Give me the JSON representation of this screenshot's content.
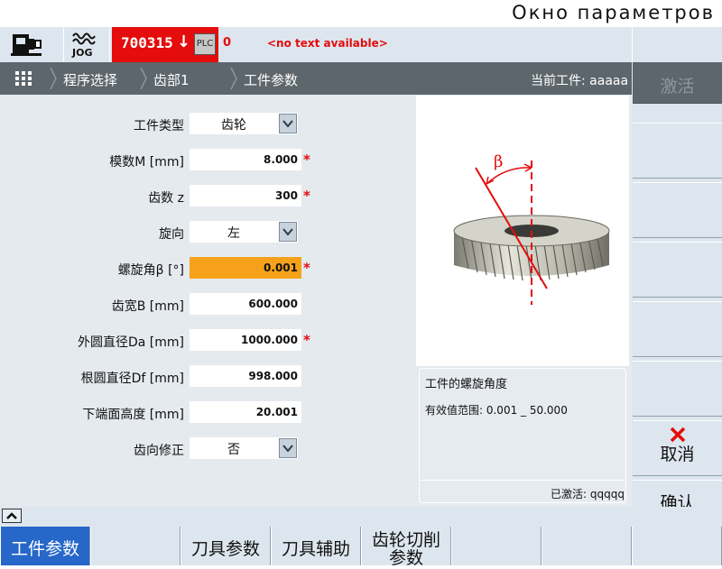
{
  "window_title": "Окно параметров",
  "header": {
    "mode": "JOG",
    "alarm_number": "700315",
    "plc_label": "PLC",
    "alarm_count": "0",
    "alarm_text": "<no text available>",
    "alarm_color": "#e40c0c"
  },
  "breadcrumb": {
    "items": [
      "程序选择",
      "齿部1",
      "工件参数"
    ],
    "current_work": "当前工件: aaaaa"
  },
  "form": {
    "workpiece_type": {
      "label": "工件类型",
      "value": "齿轮"
    },
    "module": {
      "label": "模数M [mm]",
      "value": "8.000",
      "required": "*"
    },
    "teeth": {
      "label": "齿数 z",
      "value": "300",
      "required": "*"
    },
    "direction": {
      "label": "旋向",
      "value": "左"
    },
    "helix_angle": {
      "label": "螺旋角β [°]",
      "value": "0.001",
      "required": "*"
    },
    "tooth_width": {
      "label": "齿宽B [mm]",
      "value": "600.000"
    },
    "outer_diameter": {
      "label": "外圆直径Da [mm]",
      "value": "1000.000",
      "required": "*"
    },
    "root_diameter": {
      "label": "根圆直径Df [mm]",
      "value": "998.000"
    },
    "lower_height": {
      "label": "下端面高度 [mm]",
      "value": "20.001"
    },
    "tooth_correction": {
      "label": "齿向修正",
      "value": "否"
    },
    "highlight_color": "#f5a21a"
  },
  "picture": {
    "beta_symbol": "β"
  },
  "info": {
    "title": "工件的螺旋角度",
    "range": "有效值范围: 0.001 _ 50.000",
    "activated": "已激活: qqqqq"
  },
  "vertical_softkeys": {
    "activate": "激活",
    "cancel": "取消",
    "confirm": "确认"
  },
  "horizontal_softkeys": {
    "workpiece_params": "工件参数",
    "tool_params": "刀具参数",
    "tool_aux": "刀具辅助",
    "gear_cut_line1": "齿轮切削",
    "gear_cut_line2": "参数"
  },
  "accent_color": "#2667c9"
}
